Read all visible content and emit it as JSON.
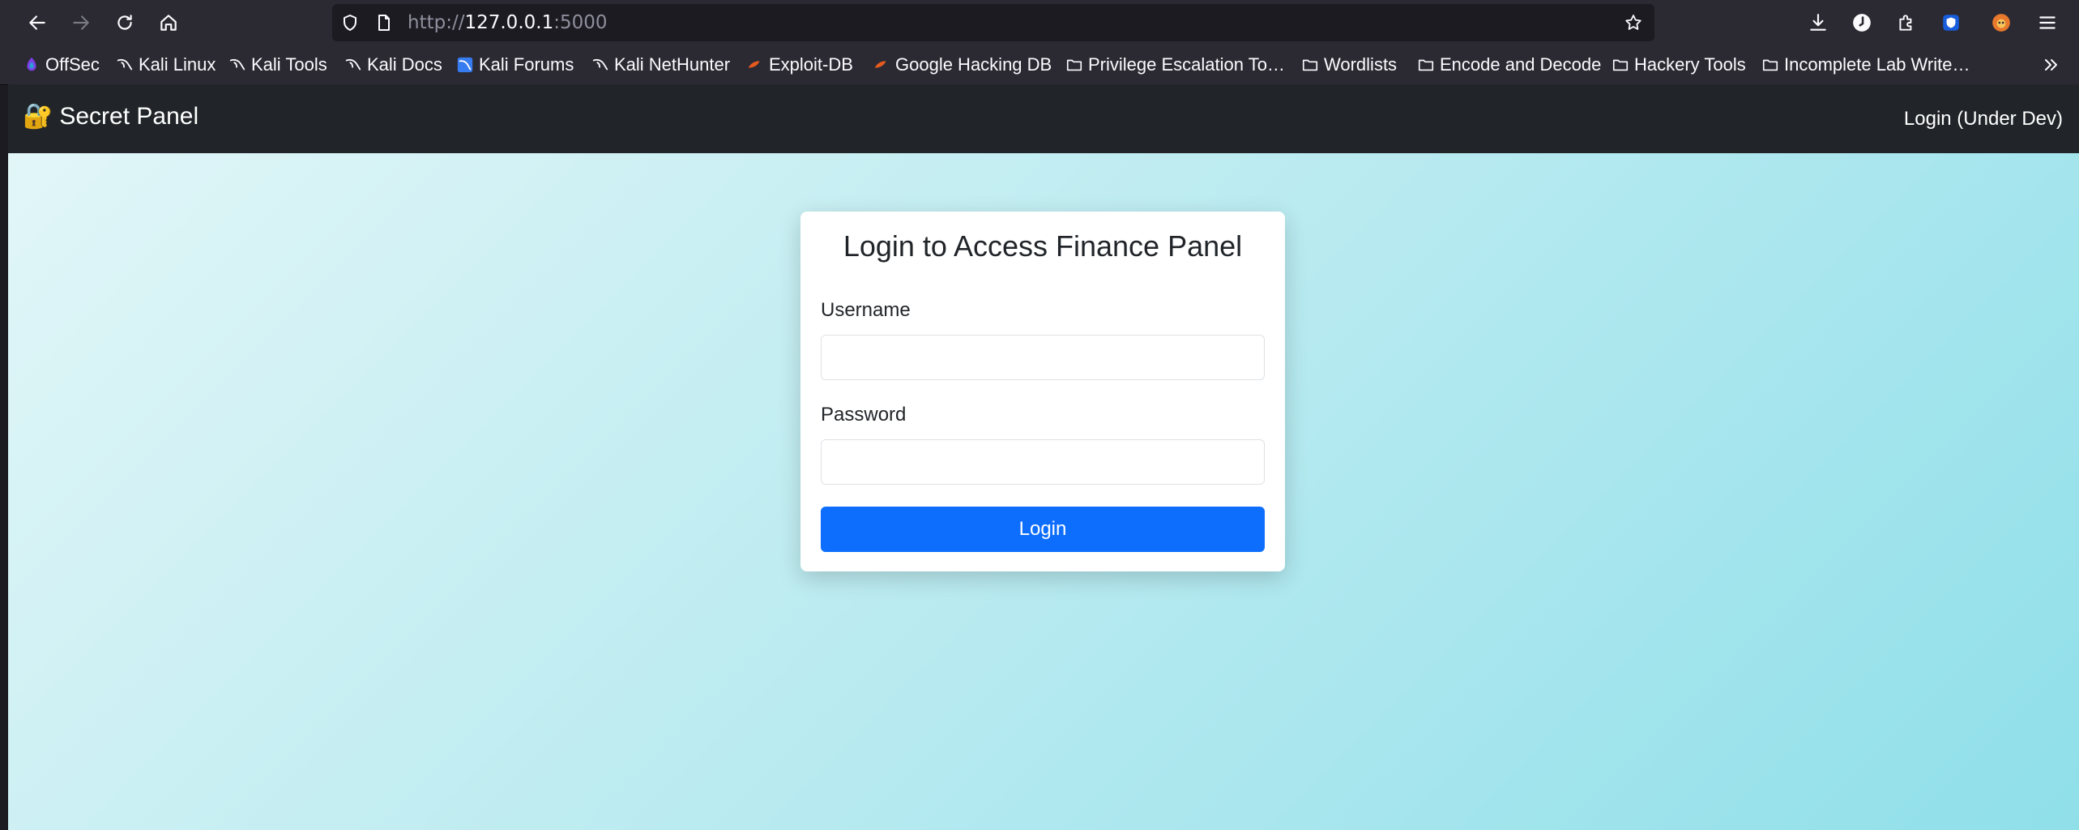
{
  "browser": {
    "url_prefix": "http://",
    "url_host": "127.0.0.1",
    "url_port": ":5000",
    "bookmarks": [
      {
        "label": "OffSec",
        "icon": "offsec-icon"
      },
      {
        "label": "Kali Linux",
        "icon": "kali-icon"
      },
      {
        "label": "Kali Tools",
        "icon": "kali-icon"
      },
      {
        "label": "Kali Docs",
        "icon": "kali-icon"
      },
      {
        "label": "Kali Forums",
        "icon": "kali-forums-icon"
      },
      {
        "label": "Kali NetHunter",
        "icon": "kali-icon"
      },
      {
        "label": "Exploit-DB",
        "icon": "exploitdb-icon"
      },
      {
        "label": "Google Hacking DB",
        "icon": "exploitdb-icon"
      },
      {
        "label": "Privilege Escalation To…",
        "icon": "folder-icon"
      },
      {
        "label": "Wordlists",
        "icon": "folder-icon"
      },
      {
        "label": "Encode and Decode",
        "icon": "folder-icon"
      },
      {
        "label": "Hackery Tools",
        "icon": "folder-icon"
      },
      {
        "label": "Incomplete Lab Write…",
        "icon": "folder-icon"
      }
    ]
  },
  "navbar": {
    "brand_emoji": "🔐",
    "brand": "Secret Panel",
    "link": "Login (Under Dev)"
  },
  "login": {
    "title": "Login to Access Finance Panel",
    "username_label": "Username",
    "username_value": "",
    "password_label": "Password",
    "password_value": "",
    "button_label": "Login"
  },
  "colors": {
    "navbar_bg": "#212529",
    "button_bg": "#0d6efd",
    "page_gradient_start": "#e2f6f8",
    "page_gradient_end": "#8fdfe9"
  }
}
